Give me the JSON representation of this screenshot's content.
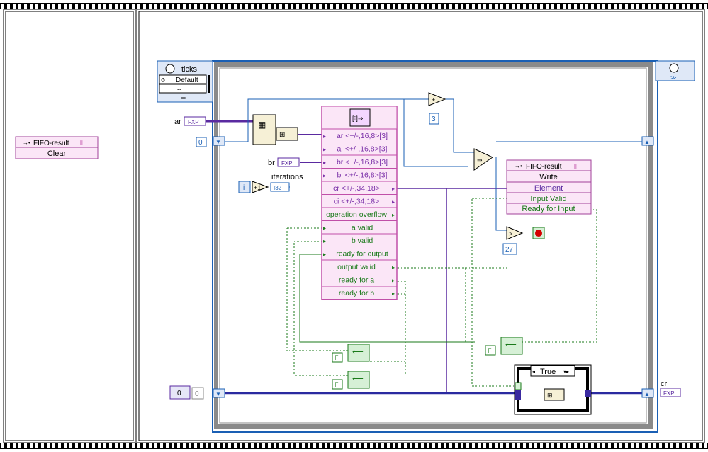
{
  "frames": {
    "count": 2
  },
  "clear_node": {
    "title": "FIFO-result",
    "method": "Clear"
  },
  "ticks": {
    "label": "ticks",
    "option1": "Default",
    "option2": "--"
  },
  "inputs": {
    "ar_label": "ar",
    "br_label": "br",
    "fxp_tag": "FXP",
    "zero_const": "0",
    "i_label": "i",
    "plus_one": "+1",
    "i32_tag": "I32",
    "iterations_label": "iterations",
    "const_3": "3",
    "const_27": "27",
    "cr_label": "cr"
  },
  "fft": {
    "ports": [
      {
        "label": "ar <+/-,16,8>[3]",
        "kind": "in",
        "color": "#7a30a8"
      },
      {
        "label": "ai <+/-,16,8>[3]",
        "kind": "in",
        "color": "#7a30a8"
      },
      {
        "label": "br <+/-,16,8>[3]",
        "kind": "in",
        "color": "#7a30a8"
      },
      {
        "label": "bi <+/-,16,8>[3]",
        "kind": "in",
        "color": "#7a30a8"
      },
      {
        "label": "cr <+/-,34,18>",
        "kind": "out",
        "color": "#7a30a8"
      },
      {
        "label": "ci <+/-,34,18>",
        "kind": "out",
        "color": "#7a30a8"
      },
      {
        "label": "operation overflow",
        "kind": "out",
        "color": "#1a7a1a"
      },
      {
        "label": "a valid",
        "kind": "in",
        "color": "#1a7a1a"
      },
      {
        "label": "b valid",
        "kind": "in",
        "color": "#1a7a1a"
      },
      {
        "label": "ready for output",
        "kind": "in",
        "color": "#1a7a1a"
      },
      {
        "label": "output valid",
        "kind": "out",
        "color": "#1a7a1a"
      },
      {
        "label": "ready for a",
        "kind": "out",
        "color": "#1a7a1a"
      },
      {
        "label": "ready for b",
        "kind": "out",
        "color": "#1a7a1a"
      }
    ]
  },
  "write_node": {
    "title": "FIFO-result",
    "method": "Write",
    "ports": [
      "Element",
      "Input Valid",
      "Ready for Input"
    ]
  },
  "bool_consts": {
    "false_label": "F"
  },
  "case": {
    "selector": "True"
  },
  "colors": {
    "fxp": "#5a2aa0",
    "bool": "#1a7a1a",
    "int": "#1a5fb4",
    "frame": "#8a8a8a",
    "node_fill": "#fbe6f7",
    "node_title": "#c04fa8"
  }
}
